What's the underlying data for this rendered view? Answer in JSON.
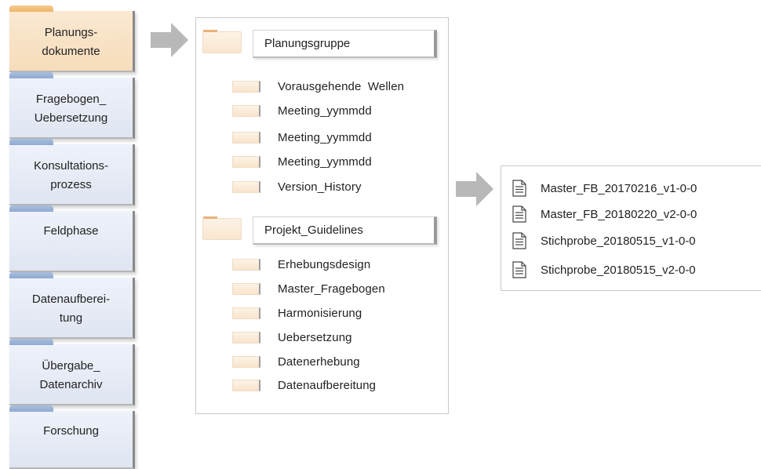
{
  "colors": {
    "active_tab": "#f6dcba",
    "inactive_tab": "#dfe5f1",
    "arrow": "#b8b8b8",
    "folder": "#f9e6cf"
  },
  "nav": {
    "items": [
      {
        "label": "Planungs-\ndokumente",
        "active": true
      },
      {
        "label": "Fragebogen_\nUebersetzung",
        "active": false
      },
      {
        "label": "Konsultations-\nprozess",
        "active": false
      },
      {
        "label": "Feldphase",
        "active": false
      },
      {
        "label": "Datenaufberei-\ntung",
        "active": false
      },
      {
        "label": "Übergabe_\nDatenarchiv",
        "active": false
      },
      {
        "label": "Forschung",
        "active": false
      }
    ]
  },
  "groups": [
    {
      "title": "Planungsgruppe",
      "folders": [
        "Vorausgehende  Wellen",
        "Meeting_yymmdd",
        "Meeting_yymmdd",
        "Meeting_yymmdd",
        "Version_History"
      ]
    },
    {
      "title": "Projekt_Guidelines",
      "folders": [
        "Erhebungsdesign",
        "Master_Fragebogen",
        "Harmonisierung",
        "Uebersetzung",
        "Datenerhebung",
        "Datenaufbereitung"
      ]
    }
  ],
  "files": [
    "Master_FB_20170216_v1-0-0",
    "Master_FB_20180220_v2-0-0",
    "Stichprobe_20180515_v1-0-0",
    "Stichprobe_20180515_v2-0-0"
  ]
}
